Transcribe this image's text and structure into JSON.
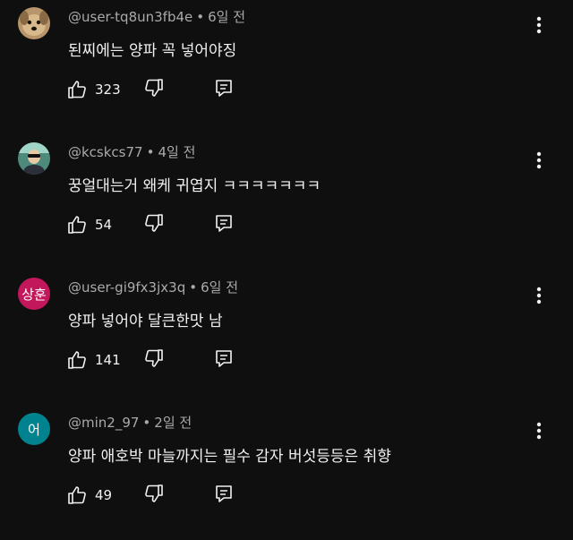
{
  "colors": {
    "background": "#0f0f0f",
    "text_primary": "#f1f1f1",
    "text_secondary": "#aaaaaa",
    "avatar_3_bg": "#c2185b",
    "avatar_4_bg": "#00838f"
  },
  "comments": [
    {
      "author": "@user-tq8un3fb4e",
      "separator": "•",
      "time": "6일 전",
      "text": "된찌에는 양파 꼭 넣어야징",
      "likes": "323",
      "avatar": {
        "type": "image",
        "icon": "dog-photo-avatar"
      }
    },
    {
      "author": "@kcskcs77",
      "separator": "•",
      "time": "4일 전",
      "text": "꿍얼대는거 왜케 귀엽지 ㅋㅋㅋㅋㅋㅋㅋ",
      "likes": "54",
      "avatar": {
        "type": "image",
        "icon": "person-photo-avatar"
      }
    },
    {
      "author": "@user-gi9fx3jx3q",
      "separator": "•",
      "time": "6일 전",
      "text": "양파 넣어야 달큰한맛 남",
      "likes": "141",
      "avatar": {
        "type": "initials",
        "initials": "상훈"
      }
    },
    {
      "author": "@min2_97",
      "separator": "•",
      "time": "2일 전",
      "text": "양파 애호박 마늘까지는 필수 감자 버섯등등은 취향",
      "likes": "49",
      "avatar": {
        "type": "initials",
        "initials": "어"
      }
    }
  ],
  "icons": {
    "like": "thumbs-up-icon",
    "dislike": "thumbs-down-icon",
    "reply": "reply-icon",
    "more": "more-vertical-icon"
  }
}
